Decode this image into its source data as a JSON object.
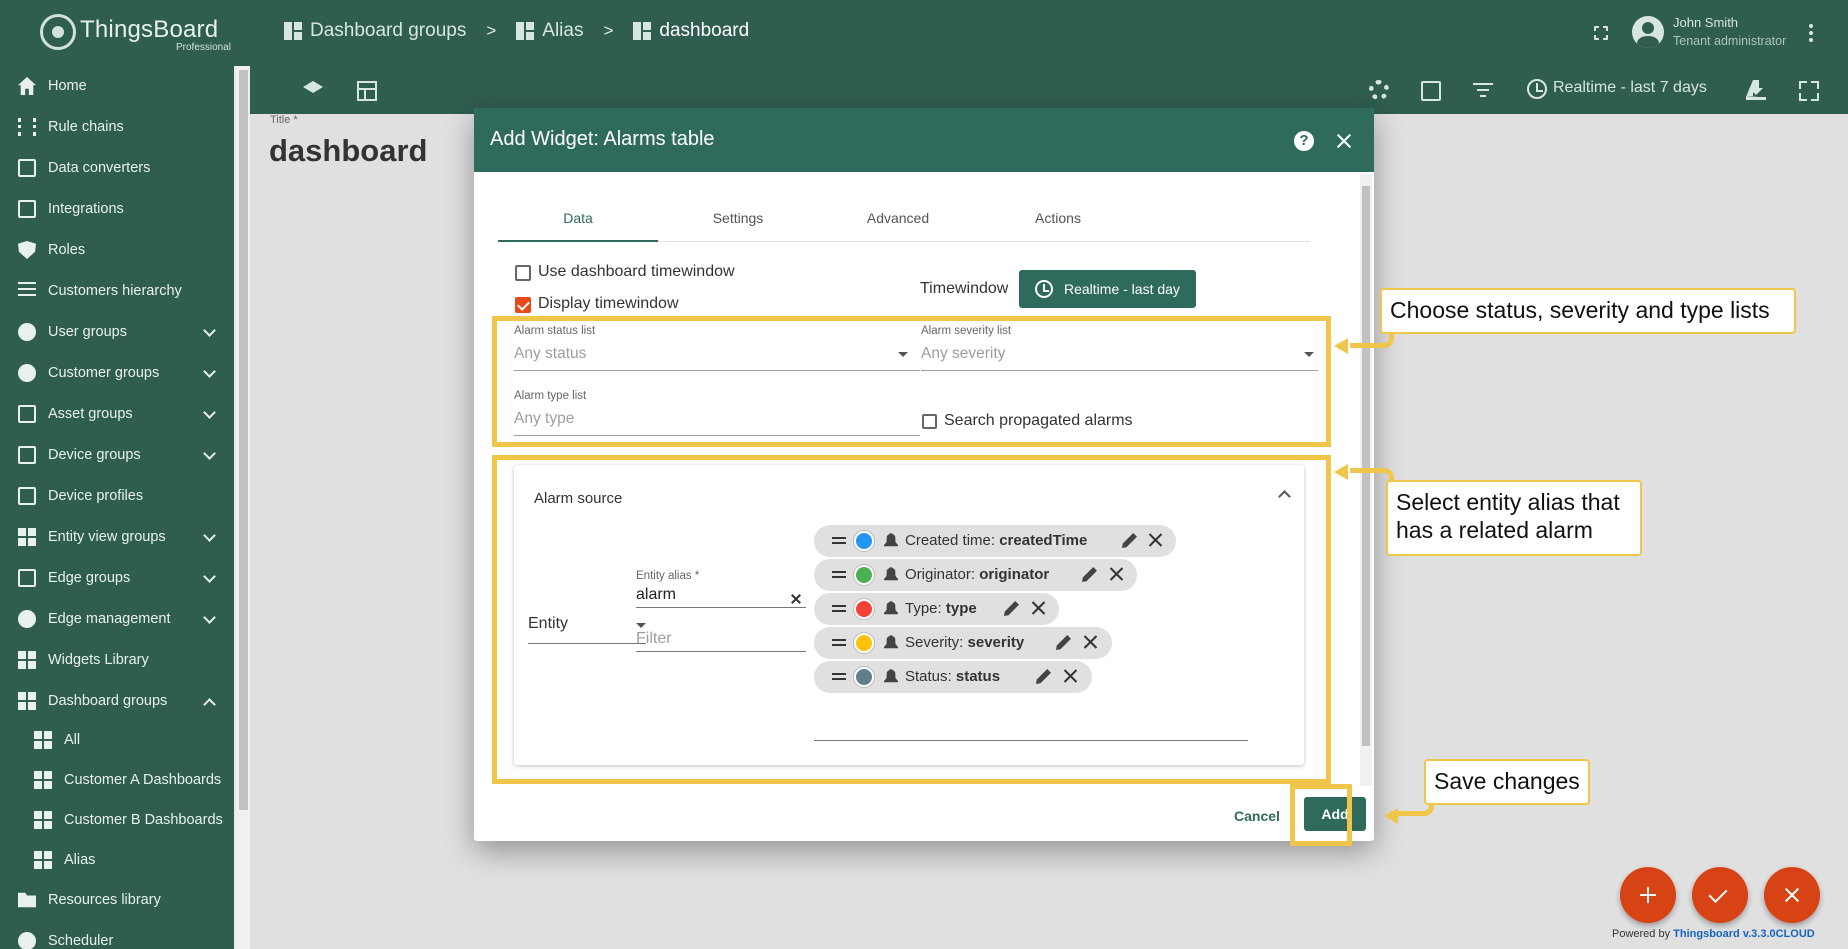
{
  "app": {
    "logo_name": "ThingsBoard",
    "logo_edition": "Professional"
  },
  "breadcrumbs": [
    {
      "label": "Dashboard groups",
      "icon": "dashboard-icon"
    },
    {
      "label": "Alias",
      "icon": "dashboard-icon"
    },
    {
      "label": "dashboard",
      "icon": "dashboard-icon"
    }
  ],
  "breadcrumb_separator": ">",
  "user": {
    "name": "John Smith",
    "role": "Tenant administrator"
  },
  "sidebar": {
    "items": [
      {
        "label": "Home",
        "icon": "home-icon"
      },
      {
        "label": "Rule chains",
        "icon": "rule-chains-icon"
      },
      {
        "label": "Data converters",
        "icon": "data-converters-icon"
      },
      {
        "label": "Integrations",
        "icon": "integrations-icon"
      },
      {
        "label": "Roles",
        "icon": "shield-icon"
      },
      {
        "label": "Customers hierarchy",
        "icon": "hierarchy-icon"
      },
      {
        "label": "User groups",
        "icon": "account-circle-icon"
      },
      {
        "label": "Customer groups",
        "icon": "people-icon"
      },
      {
        "label": "Asset groups",
        "icon": "domain-icon"
      },
      {
        "label": "Device groups",
        "icon": "devices-icon"
      },
      {
        "label": "Device profiles",
        "icon": "device-profile-icon"
      },
      {
        "label": "Entity view groups",
        "icon": "view-quilt-icon"
      },
      {
        "label": "Edge groups",
        "icon": "router-icon"
      },
      {
        "label": "Edge management",
        "icon": "settings-input-antenna-icon"
      },
      {
        "label": "Widgets Library",
        "icon": "widgets-icon"
      },
      {
        "label": "Dashboard groups",
        "icon": "dashboard-icon"
      },
      {
        "label": "All",
        "icon": "dashboard-icon"
      },
      {
        "label": "Customer A Dashboards",
        "icon": "dashboard-icon"
      },
      {
        "label": "Customer B Dashboards",
        "icon": "dashboard-icon"
      },
      {
        "label": "Alias",
        "icon": "dashboard-icon"
      },
      {
        "label": "Resources library",
        "icon": "folder-icon"
      },
      {
        "label": "Scheduler",
        "icon": "schedule-icon"
      }
    ]
  },
  "toolbar": {
    "timewindow": "Realtime - last 7 days"
  },
  "dashboard": {
    "title_label": "Title *",
    "title": "dashboard"
  },
  "dialog": {
    "title": "Add Widget: Alarms table",
    "help": "?",
    "tabs": [
      "Data",
      "Settings",
      "Advanced",
      "Actions"
    ],
    "active_tab": "Data",
    "use_dashboard_timewindow": "Use dashboard timewindow",
    "use_dashboard_timewindow_checked": false,
    "display_timewindow": "Display timewindow",
    "display_timewindow_checked": true,
    "timewindow_label": "Timewindow",
    "timewindow_value": "Realtime - last day",
    "alarm_status_label": "Alarm status list",
    "alarm_status_placeholder": "Any status",
    "alarm_severity_label": "Alarm severity list",
    "alarm_severity_placeholder": "Any severity",
    "alarm_type_label": "Alarm type list",
    "alarm_type_placeholder": "Any type",
    "search_propagated": "Search propagated alarms",
    "search_propagated_checked": false,
    "alarm_source": {
      "title": "Alarm source",
      "source_type": "Entity",
      "entity_alias_label": "Entity alias *",
      "entity_alias": "alarm",
      "filter_placeholder": "Filter",
      "keys": [
        {
          "label": "Created time: ",
          "key": "createdTime",
          "color": "#2196f3"
        },
        {
          "label": "Originator: ",
          "key": "originator",
          "color": "#4caf50"
        },
        {
          "label": "Type: ",
          "key": "type",
          "color": "#f44336"
        },
        {
          "label": "Severity: ",
          "key": "severity",
          "color": "#ffc107"
        },
        {
          "label": "Status: ",
          "key": "status",
          "color": "#607d8b"
        }
      ]
    },
    "cancel": "Cancel",
    "add": "Add"
  },
  "annotations": {
    "status_lists": "Choose status, severity and type lists",
    "entity_alias": "Select entity alias that has a related alarm",
    "save": "Save changes"
  },
  "powered_by": {
    "prefix": "Powered by ",
    "link": "Thingsboard v.3.3.0CLOUD"
  },
  "colors": {
    "primary": "#2f5d50",
    "accent": "#d84315",
    "highlight": "#f0c64a"
  }
}
